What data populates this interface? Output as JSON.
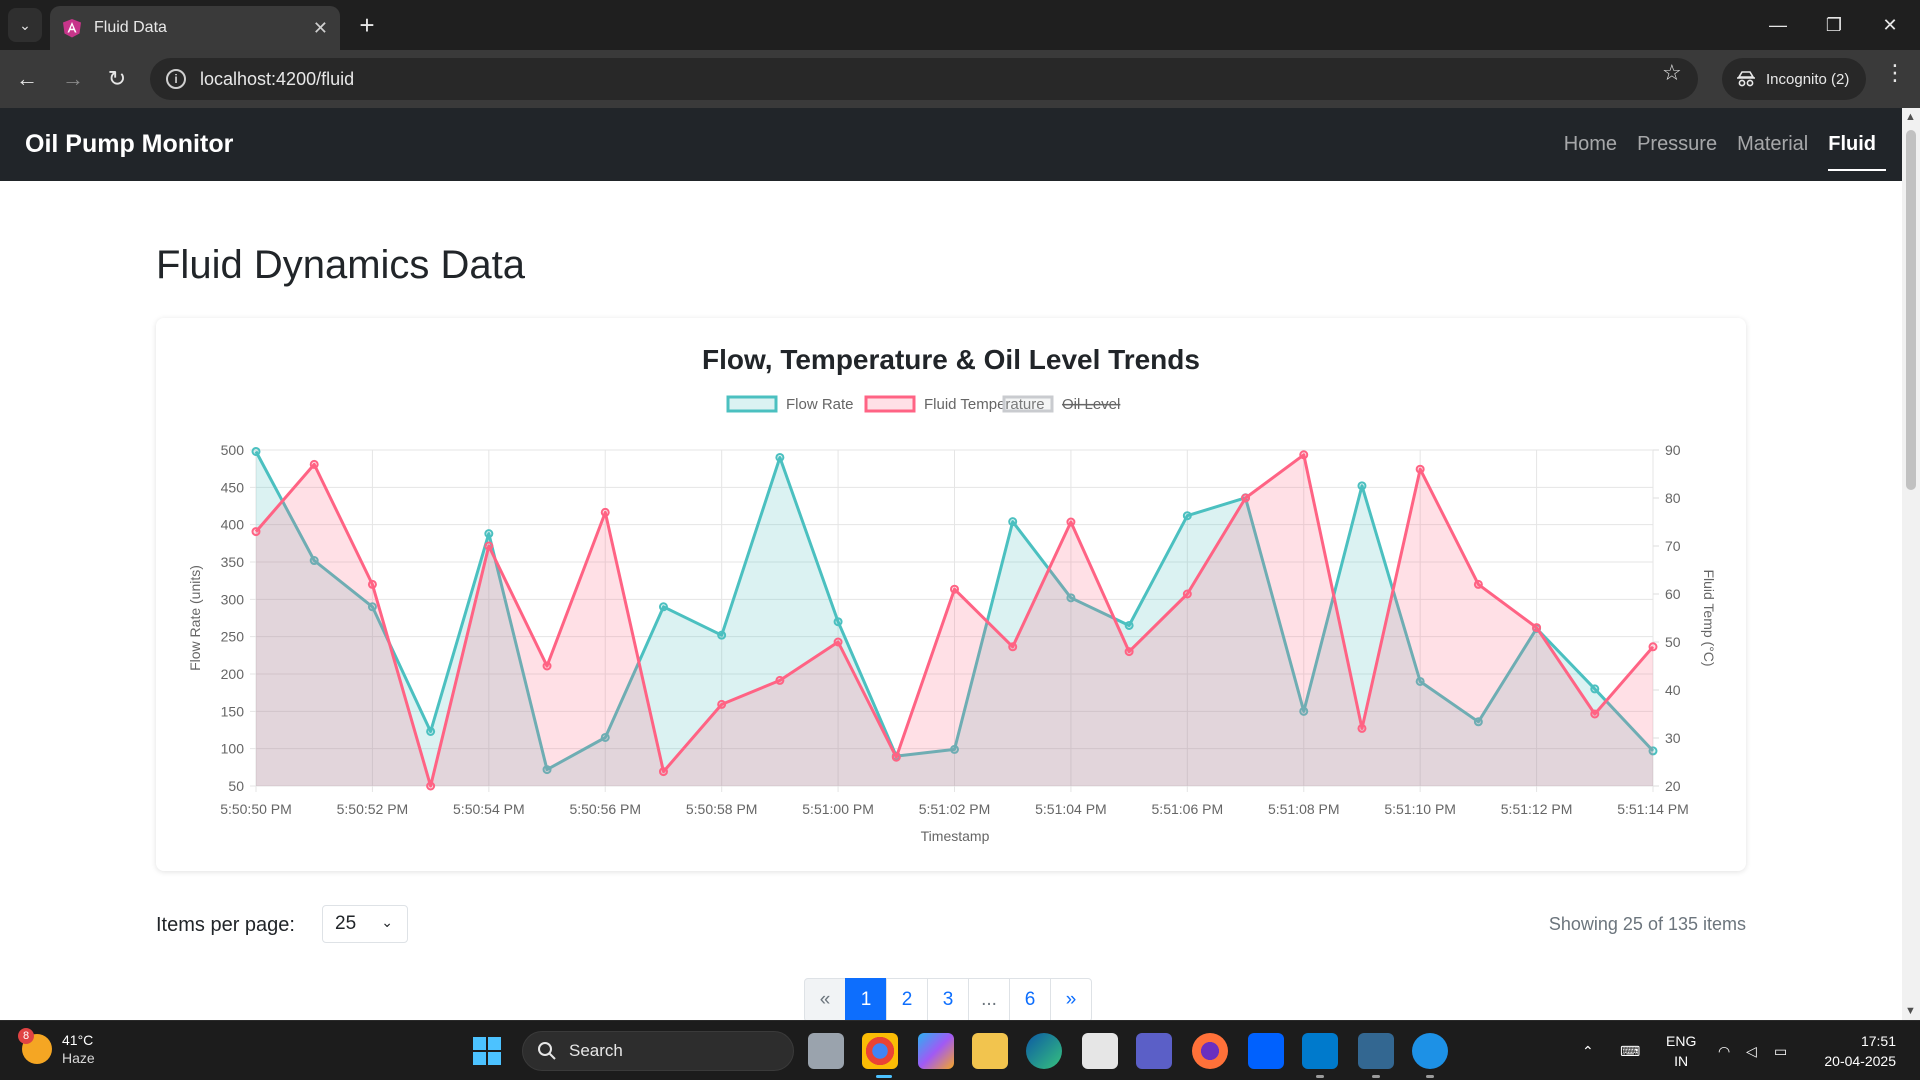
{
  "browser": {
    "tab_title": "Fluid Data",
    "url": "localhost:4200/fluid",
    "incognito_label": "Incognito (2)",
    "new_tab_glyph": "+",
    "close_glyph": "✕"
  },
  "app": {
    "brand": "Oil Pump Monitor",
    "nav": [
      {
        "label": "Home",
        "active": false
      },
      {
        "label": "Pressure",
        "active": false
      },
      {
        "label": "Material",
        "active": false
      },
      {
        "label": "Fluid",
        "active": true
      }
    ],
    "page_title": "Fluid Dynamics Data"
  },
  "chart_data": {
    "type": "line",
    "title": "Flow, Temperature & Oil Level Trends",
    "xlabel": "Timestamp",
    "ylabel_left": "Flow Rate (units)",
    "ylabel_right": "Fluid Temp (°C)",
    "ylim_left": [
      50,
      500
    ],
    "ylim_right": [
      20,
      90
    ],
    "yticks_left": [
      50,
      100,
      150,
      200,
      250,
      300,
      350,
      400,
      450,
      500
    ],
    "yticks_right": [
      20,
      30,
      40,
      50,
      60,
      70,
      80,
      90
    ],
    "x_tick_labels": [
      "5:50:50 PM",
      "5:50:52 PM",
      "5:50:54 PM",
      "5:50:56 PM",
      "5:50:58 PM",
      "5:51:00 PM",
      "5:51:02 PM",
      "5:51:04 PM",
      "5:51:06 PM",
      "5:51:08 PM",
      "5:51:10 PM",
      "5:51:12 PM",
      "5:51:14 PM"
    ],
    "grid": true,
    "legend_position": "top",
    "series": [
      {
        "name": "Flow Rate",
        "axis": "left",
        "color": "#4bc0c0",
        "fill": "rgba(75,192,192,0.2)",
        "hidden": false,
        "values": [
          498,
          352,
          290,
          123,
          388,
          72,
          115,
          290,
          252,
          490,
          270,
          90,
          99,
          404,
          302,
          265,
          412,
          436,
          150,
          452,
          190,
          136,
          261,
          180,
          97
        ]
      },
      {
        "name": "Fluid Temperature",
        "axis": "right",
        "color": "#ff6384",
        "fill": "rgba(255,99,132,0.2)",
        "hidden": false,
        "values": [
          73,
          87,
          62,
          20,
          70,
          45,
          77,
          23,
          37,
          42,
          50,
          26,
          61,
          49,
          75,
          48,
          60,
          80,
          89,
          32,
          86,
          62,
          53,
          35,
          49
        ]
      },
      {
        "name": "Oil Level",
        "axis": "left",
        "color": "#c9cbcf",
        "fill": "rgba(201,203,207,0.2)",
        "hidden": true,
        "values": []
      }
    ]
  },
  "pagination": {
    "items_per_page_label": "Items per page:",
    "items_per_page_value": "25",
    "showing": "Showing 25 of 135 items",
    "prev": "«",
    "next": "»",
    "pages": [
      "1",
      "2",
      "3",
      "...",
      "6"
    ],
    "active_page": "1"
  },
  "taskbar": {
    "weather_temp": "41°C",
    "weather_desc": "Haze",
    "weather_badge": "8",
    "search_placeholder": "Search",
    "lang_top": "ENG",
    "lang_bottom": "IN",
    "time": "17:51",
    "date": "20-04-2025"
  }
}
